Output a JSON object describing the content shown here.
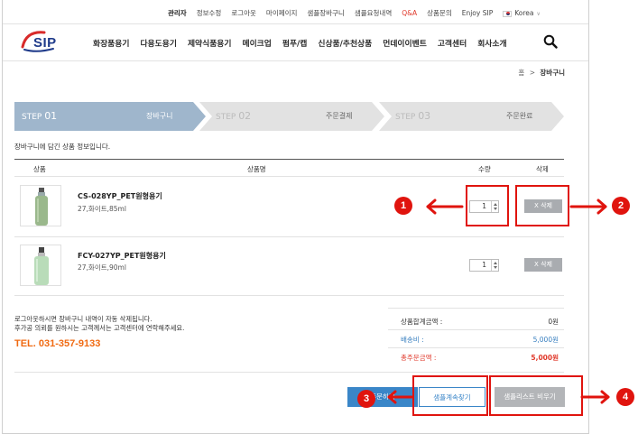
{
  "top_links": [
    "관리자",
    "정보수정",
    "로그아웃",
    "마이페이지",
    "샘플장바구니",
    "샘플요청내역",
    "Q&A",
    "상품문의",
    "Enjoy SIP"
  ],
  "language": "Korea",
  "logo": "SIP",
  "nav": [
    "화장품용기",
    "다용도용기",
    "제약식품용기",
    "메이크업",
    "펌푸/캡",
    "신상품/추천상품",
    "먼데이이벤트",
    "고객센터",
    "회사소개"
  ],
  "breadcrumb": {
    "home": "홈",
    "sep": ">",
    "current": "장바구니"
  },
  "steps": [
    {
      "no": "STEP ",
      "num": "01",
      "name": "장바구니",
      "active": true
    },
    {
      "no": "STEP ",
      "num": "02",
      "name": "주문결제",
      "active": false
    },
    {
      "no": "STEP ",
      "num": "03",
      "name": "주문완료",
      "active": false
    }
  ],
  "intro": "장바구니에 담긴 상품 정보입니다.",
  "table_headers": {
    "product": "상품",
    "name": "상품명",
    "qty": "수량",
    "delete": "삭제"
  },
  "items": [
    {
      "name": "CS-028YP_PET원형용기",
      "option": "27,화이트,85ml",
      "qty": "1",
      "delete": "X 삭제"
    },
    {
      "name": "FCY-027YP_PET원형용기",
      "option": "27,화이트,90ml",
      "qty": "1",
      "delete": "X 삭제"
    }
  ],
  "notes": [
    "로그아웃하시면 장바구니 내역이 자동 삭제됩니다.",
    "후가공 의뢰를 원하시는 고객께서는 고객센터에 연락해주세요."
  ],
  "tel": "TEL. 031-357-9133",
  "summary": [
    {
      "label": "상품합계금액 :",
      "value": "0원"
    },
    {
      "label": "배송비 :",
      "value": "5,000원"
    },
    {
      "label": "총주문금액 :",
      "value": "5,000원"
    }
  ],
  "buttons": {
    "order": "주문하기",
    "continue": "샘플계속찾기",
    "clear": "샘플리스트 비우기"
  },
  "markers": [
    "1",
    "2",
    "3",
    "4"
  ],
  "colors": {
    "accent": "#e0140e",
    "step_active": "#9fb6cc",
    "step_inactive": "#e2e2e2",
    "tel": "#f06a12",
    "order_btn": "#3a86c8"
  }
}
